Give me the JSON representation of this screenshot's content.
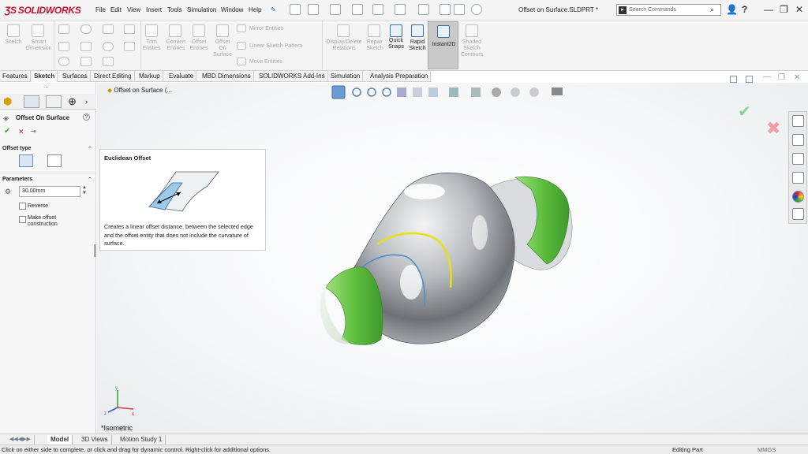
{
  "app": {
    "logo": "SOLIDWORKS",
    "doc_title": "Offset on Surface.SLDPRT *"
  },
  "menu": [
    "File",
    "Edit",
    "View",
    "Insert",
    "Tools",
    "Simulation",
    "Window",
    "Help"
  ],
  "search": {
    "placeholder": "Search Commands"
  },
  "ribbon": {
    "sketch": "Sketch",
    "smart_dimension": "Smart\nDimension",
    "trim_entities": "Trim\nEntities",
    "convert_entities": "Convert\nEntities",
    "offset_entities": "Offset\nEntities",
    "offset_on_surface": "Offset\nOn\nSurface",
    "mirror_entities": "Mirror Entities",
    "linear_sketch_pattern": "Linear Sketch Pattern",
    "move_entities": "Move Entities",
    "display_delete_relations": "Display/Delete\nRelations",
    "repair_sketch": "Repair\nSketch",
    "quick_snaps": "Quick\nSnaps",
    "rapid_sketch": "Rapid\nSketch",
    "instant2d": "Instant2D",
    "shaded_sketch_contours": "Shaded\nSketch\nContours"
  },
  "tabs": [
    "Features",
    "Sketch",
    "Surfaces",
    "Direct Editing",
    "Markup",
    "Evaluate",
    "MBD Dimensions",
    "SOLIDWORKS Add-Ins",
    "Simulation",
    "Analysis Preparation"
  ],
  "active_tab": "Sketch",
  "property_manager": {
    "title": "Offset On Surface",
    "offset_type_label": "Offset type",
    "parameters_label": "Parameters",
    "distance_value": "30.00mm",
    "reverse_label": "Reverse",
    "construction_label": "Make offset\nconstruction"
  },
  "tooltip": {
    "title": "Euclidean Offset",
    "description": "Creates a linear offset distance, between the selected edge and the offset entity that does not include the curvature of surface."
  },
  "tree": {
    "item_label": "Offset on Surface  (..."
  },
  "view": {
    "orientation_label": "*Isometric"
  },
  "bottom_tabs": [
    "Model",
    "3D Views",
    "Motion Study 1"
  ],
  "status": {
    "message": "Click on either side to complete, or click and drag for dynamic control.  Right-click for additional options.",
    "mode": "Editing Part",
    "units": "MMGS"
  },
  "colors": {
    "brand": "#c8102e",
    "highlight_green": "#5fbf3f",
    "offset_curve": "#e6e01a",
    "edge_blue": "#4a8ccc"
  }
}
